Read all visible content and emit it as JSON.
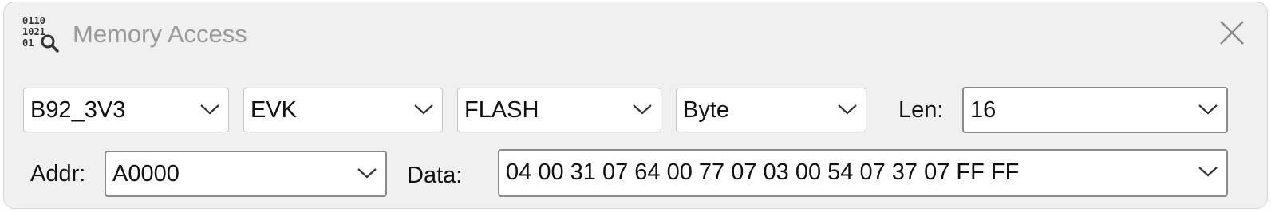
{
  "window": {
    "title": "Memory Access",
    "app_icon": "binary-search-icon",
    "close_icon": "close-icon"
  },
  "row1": {
    "device": {
      "value": "B92_3V3"
    },
    "board": {
      "value": "EVK"
    },
    "memory": {
      "value": "FLASH"
    },
    "width": {
      "value": "Byte"
    },
    "len_label": "Len:",
    "len": {
      "value": "16"
    }
  },
  "row2": {
    "addr_label": "Addr:",
    "addr": {
      "value": "A0000"
    },
    "data_label": "Data:",
    "data": {
      "value": "04 00 31 07 64 00 77 07 03 00 54 07 37 07 FF FF"
    }
  },
  "colors": {
    "window_bg": "#f0f0f0",
    "title_text": "#9a9a9a",
    "field_border": "#c6c6c6"
  }
}
